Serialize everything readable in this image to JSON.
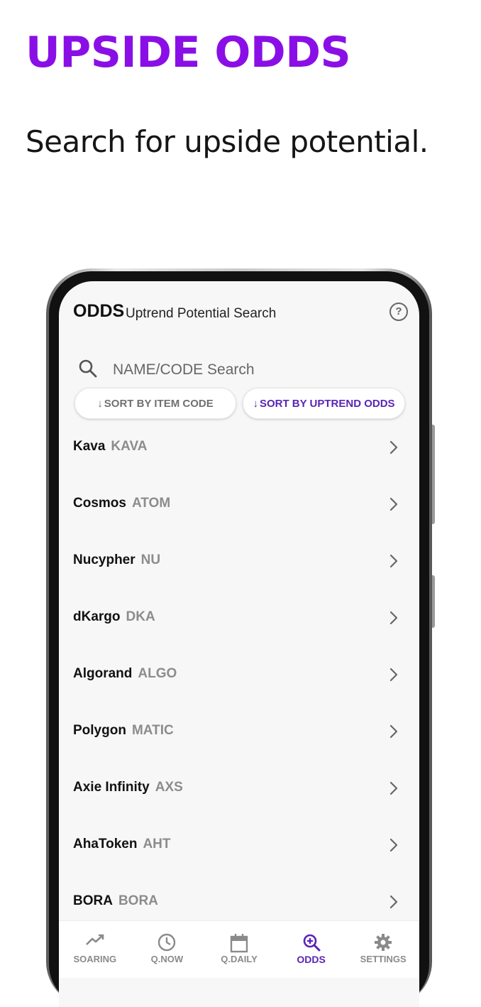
{
  "promo": {
    "title": "UPSIDE ODDS",
    "subtitle": "Search for upside potential."
  },
  "header": {
    "title": "ODDS",
    "subtitle": "Uptrend Potential Search",
    "help_icon": "question-circle-icon",
    "help_glyph": "?"
  },
  "search": {
    "icon": "search-icon",
    "placeholder": "NAME/CODE Search"
  },
  "sort": {
    "arrow": "↓",
    "by_code_label": "SORT BY ITEM CODE",
    "by_odds_label": "SORT BY UPTREND ODDS",
    "active": "odds"
  },
  "items": [
    {
      "name": "Kava",
      "code": "KAVA"
    },
    {
      "name": "Cosmos",
      "code": "ATOM"
    },
    {
      "name": "Nucypher",
      "code": "NU"
    },
    {
      "name": "dKargo",
      "code": "DKA"
    },
    {
      "name": "Algorand",
      "code": "ALGO"
    },
    {
      "name": "Polygon",
      "code": "MATIC"
    },
    {
      "name": "Axie Infinity",
      "code": "AXS"
    },
    {
      "name": "AhaToken",
      "code": "AHT"
    },
    {
      "name": "BORA",
      "code": "BORA"
    }
  ],
  "nav": {
    "active": "odds",
    "items": [
      {
        "label": "SOARING",
        "icon": "trending-up-icon"
      },
      {
        "label": "Q.NOW",
        "icon": "clock-icon"
      },
      {
        "label": "Q.DAILY",
        "icon": "calendar-icon"
      },
      {
        "label": "ODDS",
        "icon": "zoom-in-icon"
      },
      {
        "label": "SETTINGS",
        "icon": "gear-icon"
      }
    ]
  },
  "colors": {
    "accent": "#8a0fe6",
    "active_nav": "#5a24b5",
    "screen_bg": "#f7f7f7",
    "muted": "#8c8c8c"
  }
}
